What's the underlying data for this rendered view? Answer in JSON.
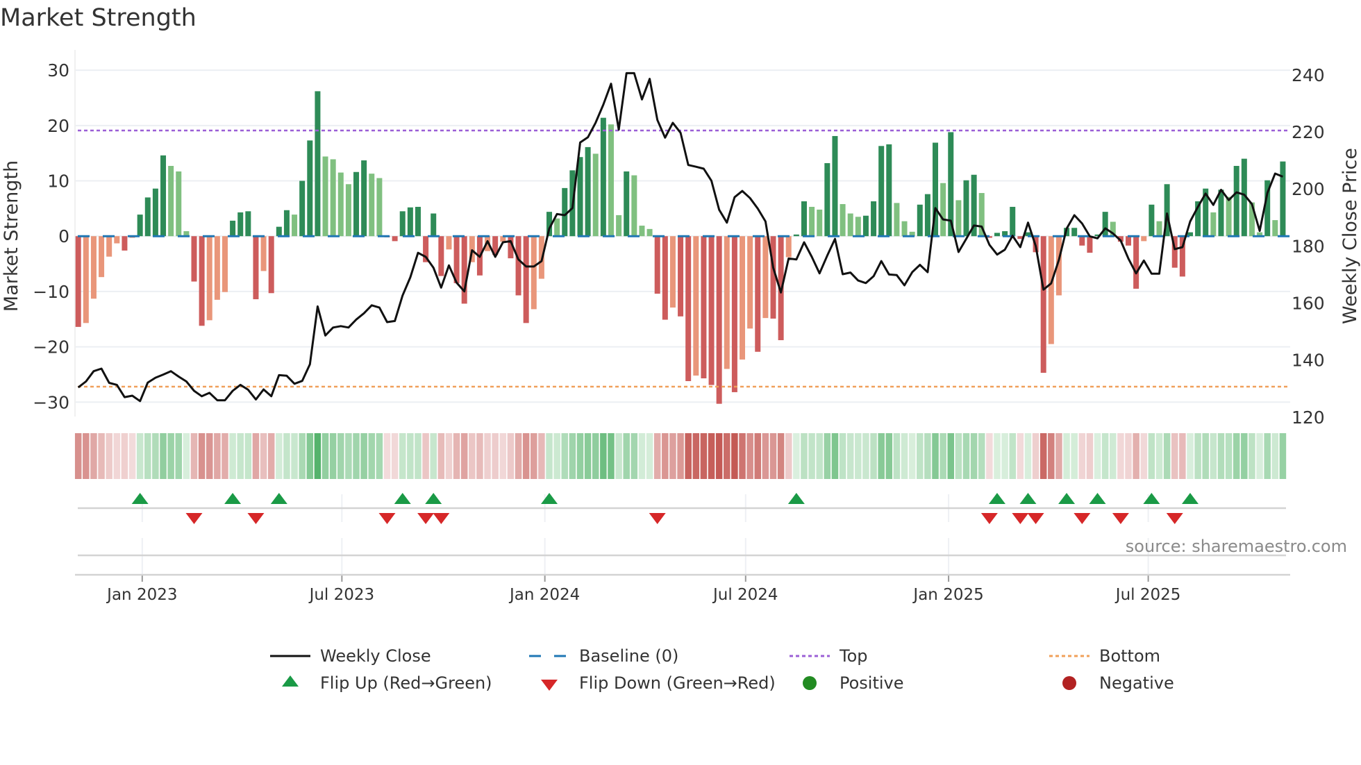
{
  "title": "Market Strength",
  "source": "source: sharemaestro.com",
  "legend": {
    "weekly_close": "Weekly Close",
    "baseline": "Baseline (0)",
    "top": "Top",
    "bottom": "Bottom",
    "flip_up": "Flip Up (Red→Green)",
    "flip_down": "Flip Down (Green→Red)",
    "positive": "Positive",
    "negative": "Negative"
  },
  "colors": {
    "bar_up_rising": "#2e8b57",
    "bar_up_falling": "#80c080",
    "bar_down_falling": "#cd5c5c",
    "bar_down_rising": "#e9967a",
    "price_line": "#111111",
    "baseline": "#1f77b4",
    "top": "#9b5fd6",
    "bottom": "#f0a05a",
    "flip_up": "#1a9a46",
    "flip_down": "#d62728",
    "positive": "#228b22",
    "negative": "#b22222",
    "grid": "#eceff3"
  },
  "chart_data": {
    "type": "bar+line",
    "title": "Market Strength",
    "start_date": "2022-11-04",
    "frequency": "weekly",
    "left_axis": {
      "label": "Market Strength",
      "ylim": [
        -32.6,
        32.4
      ],
      "ticks": [
        30,
        20,
        10,
        0,
        -10,
        -20,
        -30
      ],
      "tick_labels": [
        "30",
        "20",
        "10",
        "0",
        "−10",
        "−20",
        "−30"
      ]
    },
    "right_axis": {
      "label": "Weekly Close Price",
      "ylim": [
        120.2,
        246.3
      ],
      "ticks": [
        240,
        220,
        200,
        180,
        160,
        140,
        120
      ],
      "tick_labels": [
        "240",
        "220",
        "200",
        "180",
        "160",
        "140",
        "120"
      ]
    },
    "x_ticks": [
      {
        "label": "Jan 2023",
        "date": "2023-01-01"
      },
      {
        "label": "Jul 2023",
        "date": "2023-07-01"
      },
      {
        "label": "Jan 2024",
        "date": "2024-01-01"
      },
      {
        "label": "Jul 2024",
        "date": "2024-07-01"
      },
      {
        "label": "Jan 2025",
        "date": "2025-01-01"
      },
      {
        "label": "Jul 2025",
        "date": "2025-07-01"
      }
    ],
    "top_level": 19.1,
    "bottom_level": -27.2,
    "baseline": 0,
    "strength": [
      -16.4,
      -15.7,
      -11.3,
      -7.4,
      -3.7,
      -1.3,
      -2.6,
      -0.3,
      3.9,
      7.0,
      8.6,
      14.6,
      12.7,
      11.7,
      0.9,
      -8.2,
      -16.2,
      -15.2,
      -11.5,
      -10.1,
      2.8,
      4.3,
      4.5,
      -11.4,
      -6.3,
      -10.3,
      1.7,
      4.7,
      3.9,
      10.0,
      17.3,
      26.2,
      14.4,
      13.9,
      11.5,
      9.4,
      11.6,
      13.7,
      11.3,
      10.5,
      -0.2,
      -0.9,
      4.5,
      5.2,
      5.3,
      -4.7,
      4.1,
      -7.2,
      -2.4,
      -8.5,
      -12.2,
      -4.7,
      -7.1,
      -2.7,
      -3.4,
      -1.0,
      -4.0,
      -10.7,
      -15.7,
      -13.2,
      -7.7,
      4.4,
      3.2,
      8.7,
      11.9,
      14.3,
      16.1,
      14.9,
      21.4,
      20.2,
      3.8,
      11.7,
      11.0,
      1.9,
      1.3,
      -10.4,
      -15.1,
      -12.9,
      -14.5,
      -26.2,
      -25.2,
      -25.7,
      -26.9,
      -30.3,
      -24.0,
      -28.2,
      -22.3,
      -16.7,
      -20.9,
      -14.8,
      -14.9,
      -18.8,
      -3.8,
      0.3,
      6.3,
      5.3,
      4.8,
      13.2,
      18.1,
      5.8,
      4.1,
      3.5,
      3.7,
      6.3,
      16.3,
      16.6,
      6.0,
      2.7,
      0.8,
      5.7,
      7.6,
      16.9,
      9.6,
      18.8,
      6.5,
      10.1,
      11.1,
      7.8,
      -0.3,
      0.6,
      0.9,
      5.3,
      -0.5,
      0.7,
      -2.9,
      -24.7,
      -19.5,
      -10.7,
      1.5,
      1.5,
      -1.7,
      -3.0,
      0.3,
      4.4,
      2.6,
      -1.0,
      -1.7,
      -9.5,
      -0.9,
      5.7,
      2.7,
      9.4,
      -5.7,
      -7.3,
      0.7,
      6.3,
      8.6,
      4.3,
      8.4,
      7.1,
      12.7,
      14.0,
      6.1,
      0.7,
      10.1,
      2.9,
      13.5
    ],
    "weekly_close": [
      130.4,
      132.5,
      136.1,
      137.0,
      132.0,
      131.3,
      127.0,
      127.5,
      125.6,
      132.1,
      133.8,
      134.9,
      136.1,
      134.2,
      132.5,
      129.2,
      127.3,
      128.5,
      125.9,
      125.9,
      129.2,
      131.3,
      129.6,
      126.2,
      129.7,
      127.3,
      134.7,
      134.5,
      131.7,
      132.7,
      138.5,
      158.8,
      148.6,
      151.4,
      151.9,
      151.4,
      154.2,
      156.4,
      159.2,
      158.4,
      153.3,
      153.7,
      162.6,
      169.0,
      177.6,
      176.2,
      172.4,
      165.4,
      173.2,
      167.1,
      164.1,
      178.5,
      176.2,
      181.7,
      176.2,
      181.3,
      181.7,
      175.3,
      172.8,
      172.8,
      174.7,
      186.1,
      191.2,
      190.8,
      193.3,
      216.3,
      218.1,
      223.2,
      229.6,
      236.9,
      220.8,
      240.6,
      240.6,
      231.4,
      238.6,
      224.2,
      218.0,
      223.2,
      219.7,
      208.4,
      207.8,
      207.1,
      202.9,
      192.7,
      188.2,
      197.1,
      199.3,
      196.8,
      193.1,
      188.6,
      172.4,
      163.7,
      175.6,
      175.3,
      181.3,
      176.2,
      170.4,
      176.6,
      182.5,
      170.1,
      170.7,
      167.9,
      167.0,
      169.4,
      174.7,
      170.0,
      169.8,
      166.2,
      170.8,
      173.4,
      170.8,
      193.3,
      189.3,
      188.9,
      177.9,
      182.5,
      187.2,
      186.8,
      180.4,
      177.0,
      178.7,
      183.6,
      179.6,
      188.2,
      180.0,
      164.7,
      166.9,
      175.1,
      186.1,
      190.8,
      187.9,
      183.4,
      182.7,
      186.2,
      184.4,
      181.9,
      175.6,
      170.4,
      174.9,
      170.3,
      170.3,
      191.4,
      178.9,
      179.6,
      188.6,
      193.7,
      198.4,
      194.4,
      199.7,
      196.1,
      198.8,
      198.0,
      194.7,
      185.3,
      198.6,
      205.4,
      204.3
    ],
    "flip_up_weeks": [
      8,
      20,
      26,
      42,
      46,
      61,
      93,
      119,
      123,
      128,
      132,
      139,
      144
    ],
    "flip_down_weeks": [
      15,
      23,
      40,
      45,
      47,
      75,
      118,
      122,
      124,
      130,
      135,
      142
    ]
  }
}
